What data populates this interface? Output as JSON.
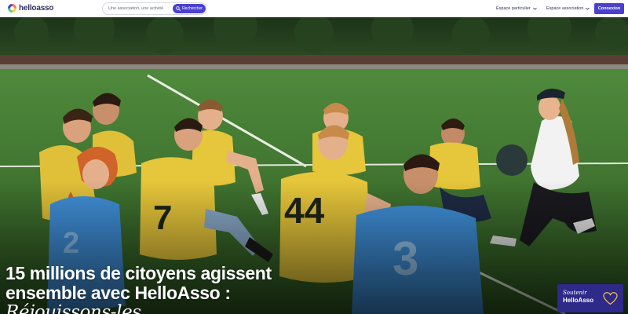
{
  "header": {
    "logo_text": "helloasso",
    "search": {
      "placeholder": "Une association, une activité",
      "button_label": "Rechercher"
    },
    "nav": {
      "particulier_label": "Espace particulier",
      "association_label": "Espace association"
    },
    "login_label": "Connexion"
  },
  "hero": {
    "title_line1": "15 millions de citoyens agissent",
    "title_line2": "ensemble avec HelloAsso :",
    "title_line3": "Réjouissons-les"
  },
  "support_badge": {
    "line1": "Soutenir",
    "line2": "HelloAsso"
  },
  "colors": {
    "brand": "#4c40cf",
    "badge": "#2d2a8a",
    "jersey_yellow": "#e8c83a",
    "jersey_blue": "#3f8fd8"
  }
}
